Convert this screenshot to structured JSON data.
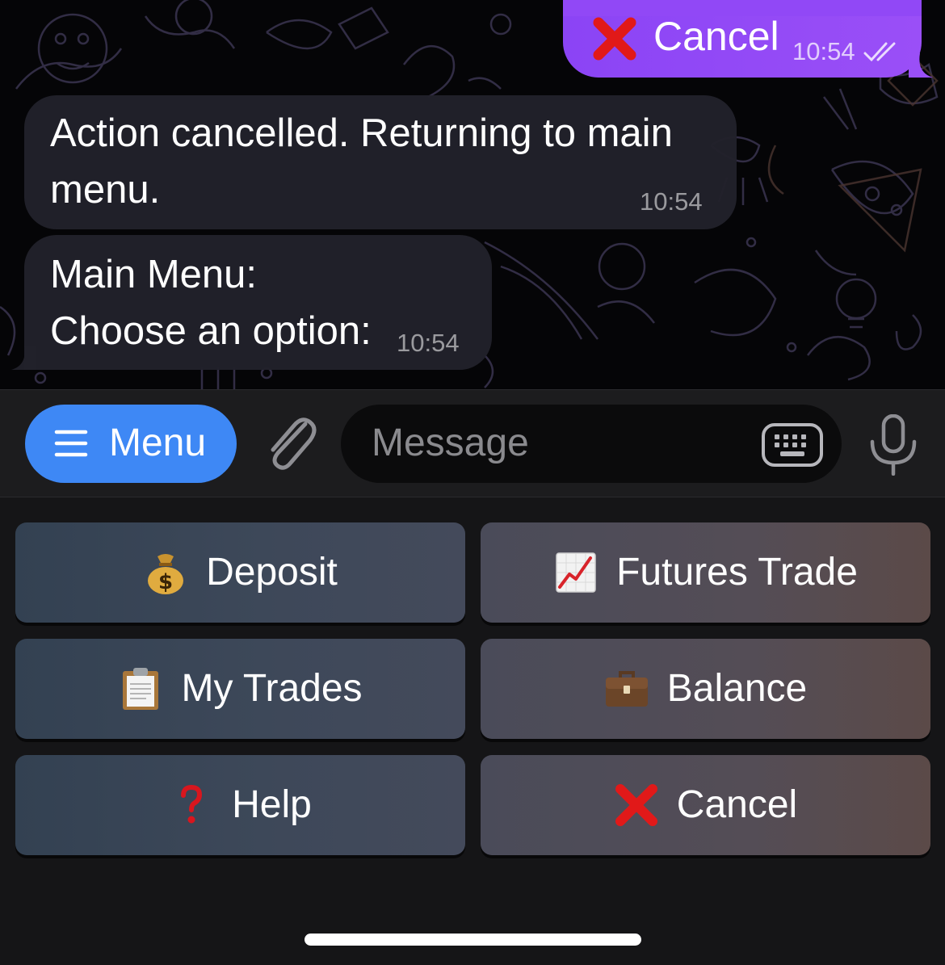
{
  "chat": {
    "outgoing": {
      "emoji": "cross-mark-icon",
      "text": "Cancel",
      "time": "10:54",
      "status": "read-double-check-icon"
    },
    "messages": [
      {
        "text": "Action cancelled. Returning to main\nmenu.",
        "time": "10:54"
      },
      {
        "text": "Main Menu:\nChoose an option:",
        "time": "10:54"
      }
    ]
  },
  "input_bar": {
    "menu_label": "Menu",
    "message_placeholder": "Message"
  },
  "keyboard": {
    "buttons": [
      {
        "icon": "money-bag-icon",
        "label": "Deposit"
      },
      {
        "icon": "chart-increasing-icon",
        "label": "Futures Trade"
      },
      {
        "icon": "clipboard-icon",
        "label": "My Trades"
      },
      {
        "icon": "briefcase-icon",
        "label": "Balance"
      },
      {
        "icon": "question-mark-icon",
        "label": "Help"
      },
      {
        "icon": "cross-mark-icon",
        "label": "Cancel"
      }
    ]
  },
  "colors": {
    "outgoing_bubble": "#9148f6",
    "incoming_bubble": "#21212b",
    "menu_button": "#3e88f5",
    "background": "#050507"
  }
}
